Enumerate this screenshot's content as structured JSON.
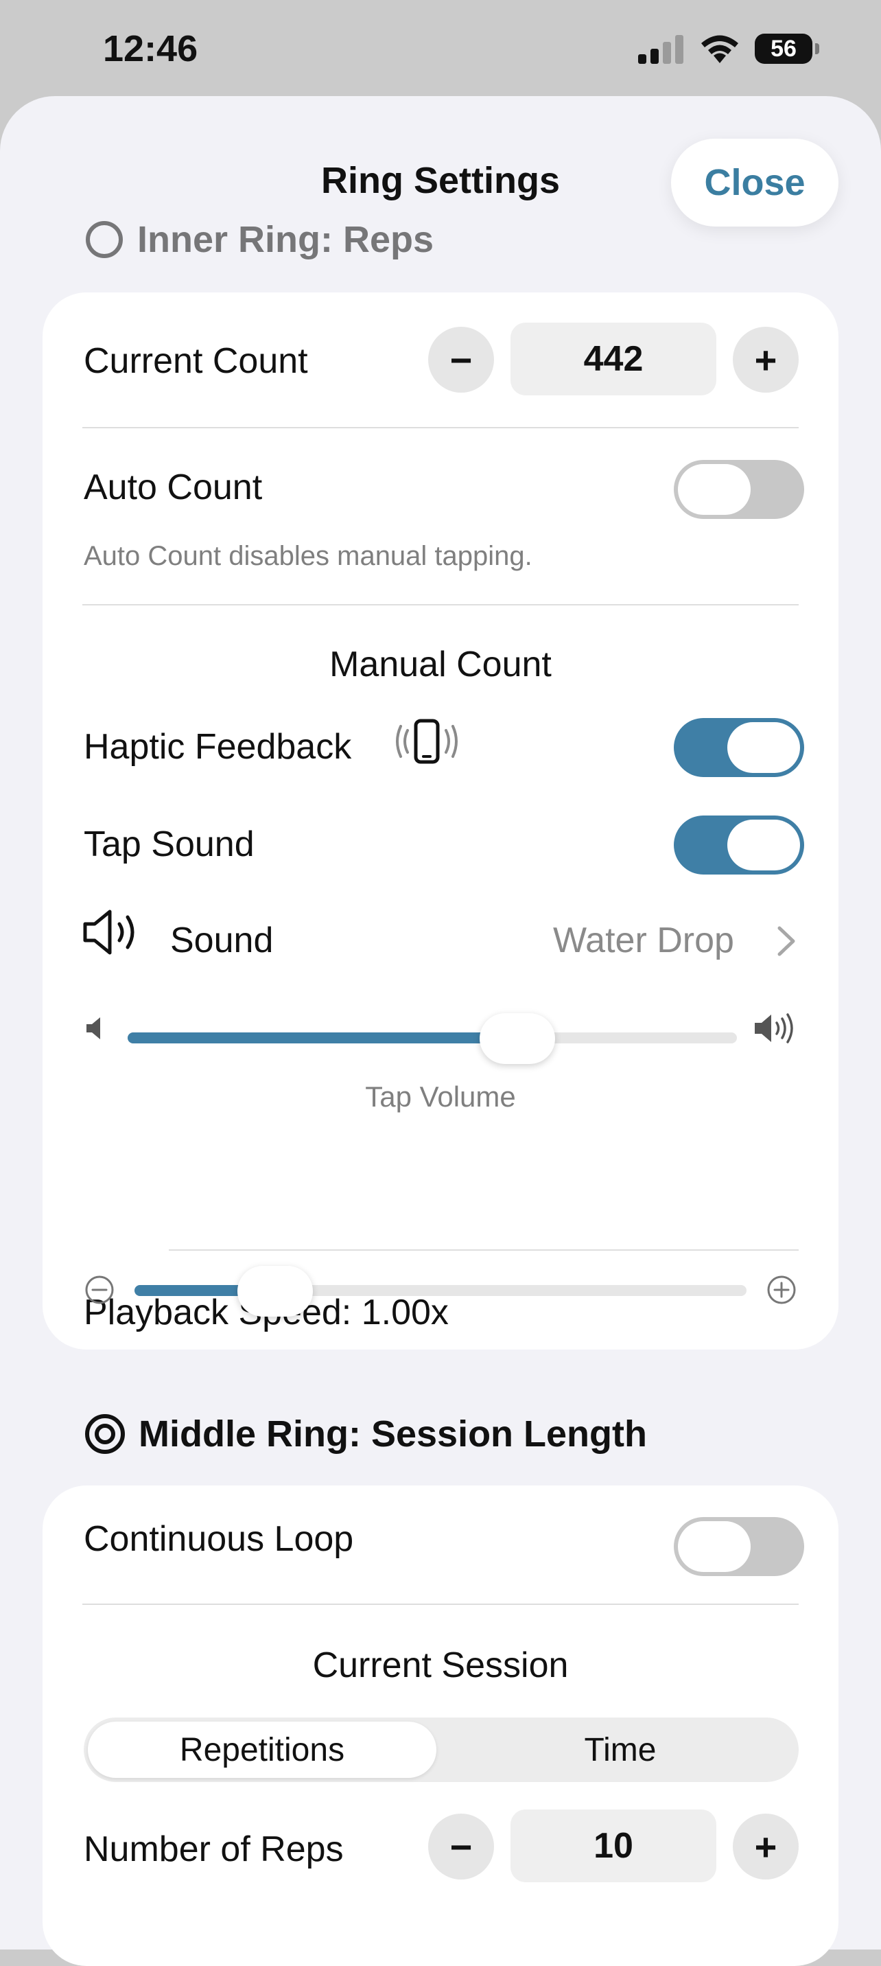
{
  "status_bar": {
    "time": "12:46",
    "battery": "56"
  },
  "sheet": {
    "title": "Ring Settings",
    "close_label": "Close"
  },
  "inner_ring": {
    "header": "Inner Ring: Reps",
    "current_count": {
      "label": "Current Count",
      "value": "442",
      "minus": "−",
      "plus": "+"
    },
    "auto_count": {
      "label": "Auto Count",
      "enabled": false,
      "footnote": "Auto Count disables manual tapping."
    },
    "manual_count": {
      "title": "Manual Count",
      "haptic": {
        "label": "Haptic Feedback",
        "enabled": true
      },
      "tap_sound": {
        "label": "Tap Sound",
        "enabled": true
      },
      "sound": {
        "label": "Sound",
        "value": "Water Drop"
      },
      "tap_volume": {
        "label": "Tap Volume",
        "level": 0.64
      },
      "playback_speed": {
        "label": "Playback Speed: 1.00x",
        "level": 0.23
      }
    }
  },
  "middle_ring": {
    "header": "Middle Ring: Session Length",
    "continuous_loop": {
      "label": "Continuous Loop",
      "enabled": false
    },
    "current_session": {
      "title": "Current Session",
      "segments": [
        "Repetitions",
        "Time"
      ],
      "selected": "Repetitions"
    },
    "number_of_reps": {
      "label": "Number of Reps",
      "value": "10",
      "minus": "−",
      "plus": "+"
    }
  },
  "colors": {
    "accent": "#3f7fa6",
    "close_text": "#3b7ea1",
    "toggle_off": "#c7c7c7"
  }
}
